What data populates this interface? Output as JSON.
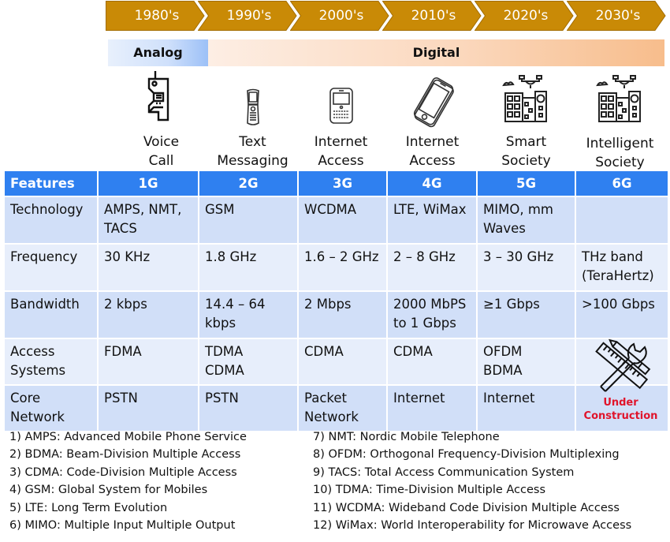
{
  "timeline": {
    "decades": [
      "1980's",
      "1990's",
      "2000's",
      "2010's",
      "2020's",
      "2030's"
    ],
    "color": "#c98a06",
    "border_color": "#a36d00"
  },
  "eras": {
    "analog": "Analog",
    "digital": "Digital"
  },
  "services": [
    {
      "icon": "brick-phone-icon",
      "label_lines": [
        "Voice",
        "Call"
      ]
    },
    {
      "icon": "flip-phone-icon",
      "label_lines": [
        "Text",
        "Messaging"
      ]
    },
    {
      "icon": "qwerty-phone-icon",
      "label_lines": [
        "Internet",
        "Access"
      ]
    },
    {
      "icon": "smartphone-icon",
      "label_lines": [
        "Internet",
        "Access"
      ]
    },
    {
      "icon": "smart-city-drone-icon",
      "label_lines": [
        "Smart",
        "Society"
      ]
    },
    {
      "icon": "smart-city-drone-icon",
      "label_lines": [
        "Intelligent",
        "Society"
      ]
    }
  ],
  "table": {
    "header_color": "#2f80f0",
    "headers": [
      "Features",
      "1G",
      "2G",
      "3G",
      "4G",
      "5G",
      "6G"
    ],
    "rows": [
      {
        "feature": [
          "Technology"
        ],
        "cells": [
          [
            "AMPS, NMT,",
            "TACS"
          ],
          [
            "GSM"
          ],
          [
            "WCDMA"
          ],
          [
            "LTE, WiMax"
          ],
          [
            "MIMO, mm",
            "Waves"
          ],
          [
            ""
          ]
        ]
      },
      {
        "feature": [
          "Frequency"
        ],
        "cells": [
          [
            "30 KHz"
          ],
          [
            "1.8 GHz"
          ],
          [
            "1.6 – 2 GHz"
          ],
          [
            "2 – 8 GHz"
          ],
          [
            "3 – 30 GHz"
          ],
          [
            "THz band",
            "(TeraHertz)"
          ]
        ]
      },
      {
        "feature": [
          "Bandwidth"
        ],
        "cells": [
          [
            "2 kbps"
          ],
          [
            "14.4 – 64",
            "kbps"
          ],
          [
            "2 Mbps"
          ],
          [
            "2000 MbPS",
            "to 1 Gbps"
          ],
          [
            "≥1 Gbps"
          ],
          [
            ">100 Gbps"
          ]
        ]
      },
      {
        "feature": [
          "Access",
          "Systems"
        ],
        "cells": [
          [
            "FDMA"
          ],
          [
            "TDMA",
            "CDMA"
          ],
          [
            "CDMA"
          ],
          [
            "CDMA"
          ],
          [
            "OFDM",
            "BDMA"
          ],
          [
            ""
          ]
        ]
      },
      {
        "feature": [
          "Core",
          "Network"
        ],
        "cells": [
          [
            "PSTN"
          ],
          [
            "PSTN"
          ],
          [
            "Packet",
            "Network"
          ],
          [
            "Internet"
          ],
          [
            "Internet"
          ],
          [
            ""
          ]
        ]
      }
    ],
    "under_construction": {
      "icon": "ruler-pencil-wrench-icon",
      "label_lines": [
        "Under",
        "Construction"
      ],
      "color": "#e0142b"
    }
  },
  "footnotes": {
    "left": [
      "1) AMPS: Advanced Mobile Phone Service",
      "2) BDMA: Beam-Division Multiple Access",
      "3) CDMA: Code-Division Multiple Access",
      "4) GSM: Global System for Mobiles",
      "5) LTE: Long Term Evolution",
      "6) MIMO: Multiple Input Multiple Output"
    ],
    "right": [
      "7) NMT: Nordic Mobile Telephone",
      "8) OFDM: Orthogonal Frequency-Division Multiplexing",
      "9) TACS: Total Access Communication System",
      "10) TDMA: Time-Division Multiple Access",
      "11) WCDMA: Wideband Code Division Multiple Access",
      "12) WiMax: World Interoperability for Microwave Access"
    ]
  }
}
